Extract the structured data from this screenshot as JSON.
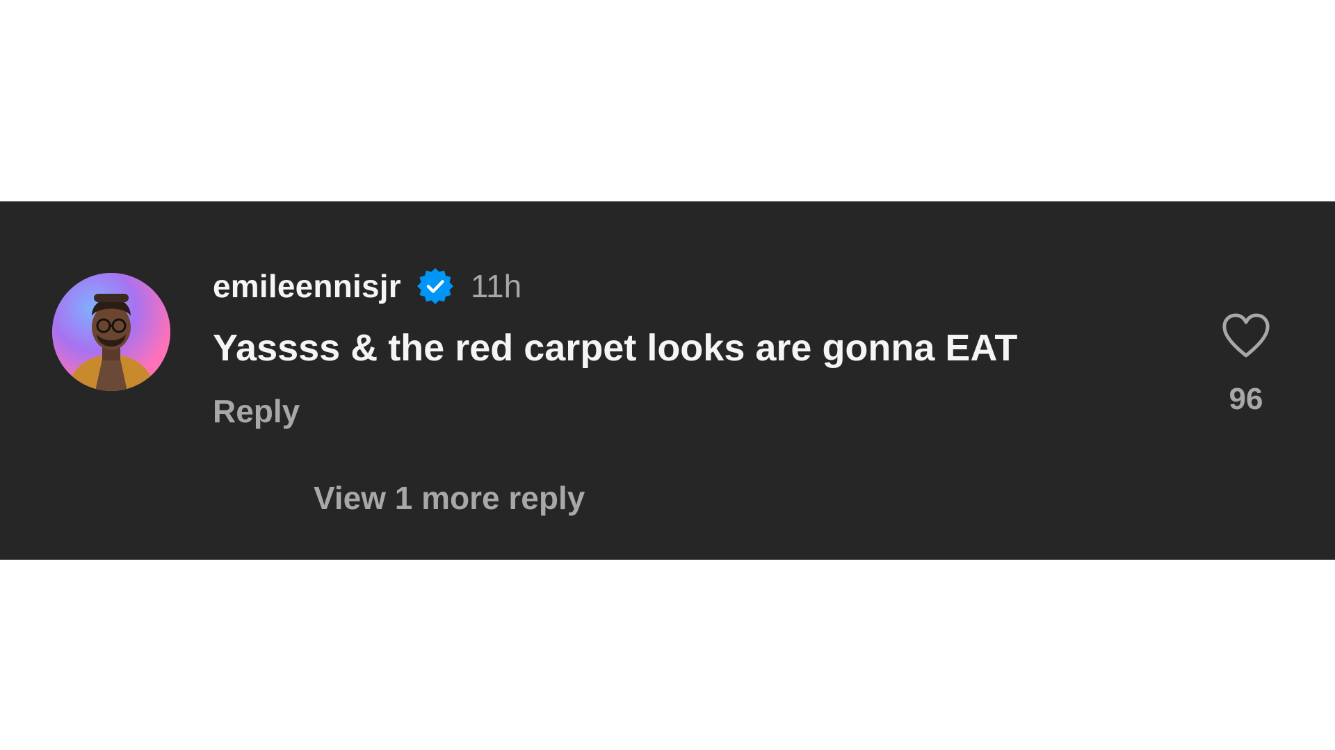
{
  "comment": {
    "username": "emileennisjr",
    "verified_icon": "verified-badge-icon",
    "timestamp": "11h",
    "text": "Yassss & the red carpet looks are gonna EAT",
    "reply_label": "Reply",
    "view_replies_label": "View 1 more reply",
    "like_icon": "heart-outline-icon",
    "like_count": "96"
  },
  "colors": {
    "panel_background": "#262626",
    "primary_text": "#f5f5f5",
    "secondary_text": "#a8a8a8",
    "verified_blue": "#0095f6"
  }
}
